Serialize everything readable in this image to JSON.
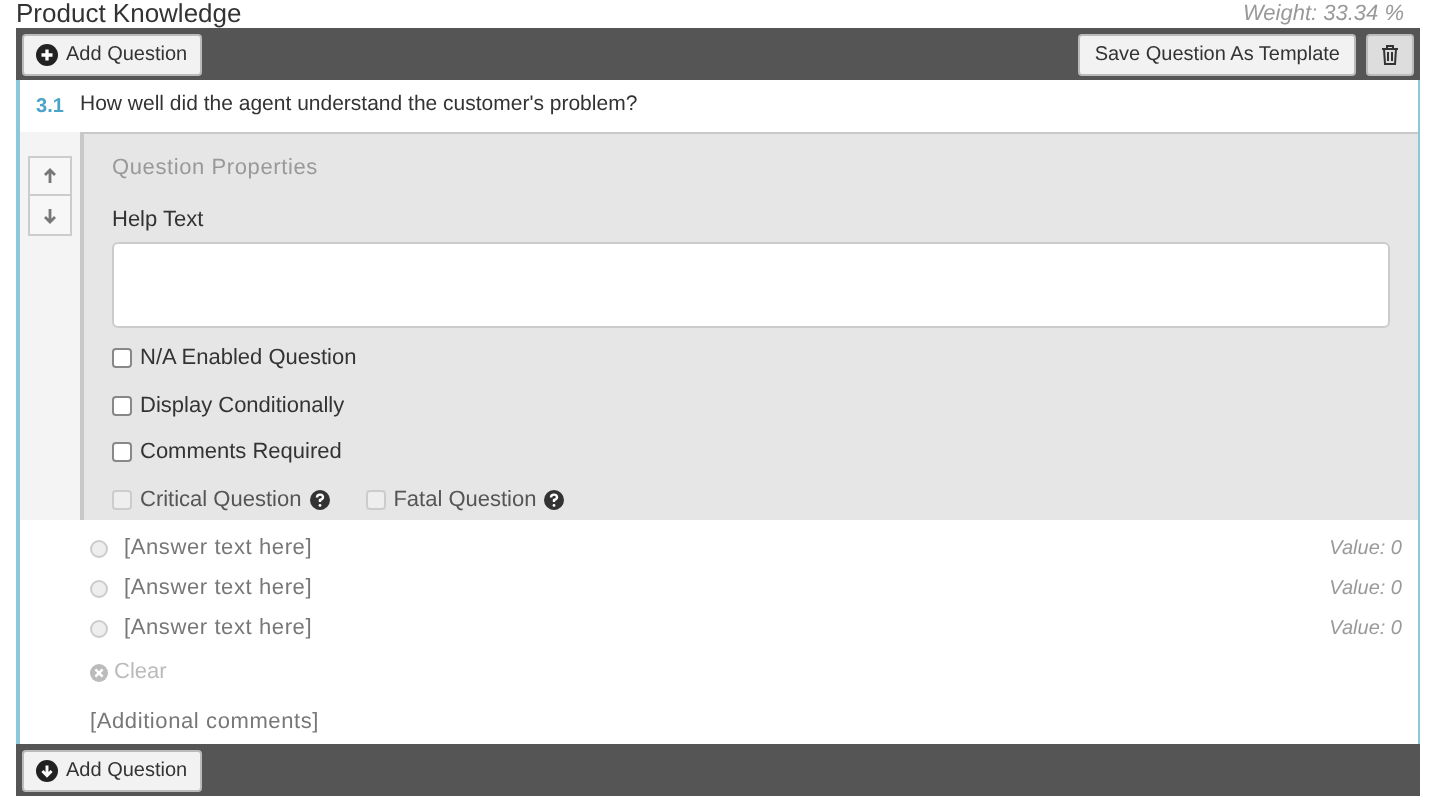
{
  "section": {
    "title": "Product Knowledge",
    "weight": "Weight: 33.34 %"
  },
  "top_toolbar": {
    "add_button": "Add Question",
    "template_button": "Save Question As Template"
  },
  "question": {
    "number": "3.1",
    "text": "How well did the agent understand the customer's problem?"
  },
  "properties": {
    "title": "Question Properties",
    "help_label": "Help Text",
    "options": [
      {
        "label": "N/A Enabled Question",
        "checked": false,
        "disabled": false,
        "help": false
      },
      {
        "label": "Display Conditionally",
        "checked": false,
        "disabled": false,
        "help": false
      },
      {
        "label": "Comments Required",
        "checked": false,
        "disabled": false,
        "help": false
      },
      {
        "label": "Critical Question",
        "checked": false,
        "disabled": true,
        "help": true
      },
      {
        "label": "Fatal Question",
        "checked": false,
        "disabled": true,
        "help": true
      }
    ]
  },
  "answers": [
    {
      "text": "[Answer text here]",
      "value": "Value: 0",
      "selected": false
    },
    {
      "text": "[Answer text here]",
      "value": "Value: 0",
      "selected": false
    },
    {
      "text": "[Answer text here]",
      "value": "Value: 0",
      "selected": false
    }
  ],
  "clear": "Clear",
  "comments": "[Additional comments]",
  "bottom_toolbar": {
    "add_button": "Add Question"
  }
}
